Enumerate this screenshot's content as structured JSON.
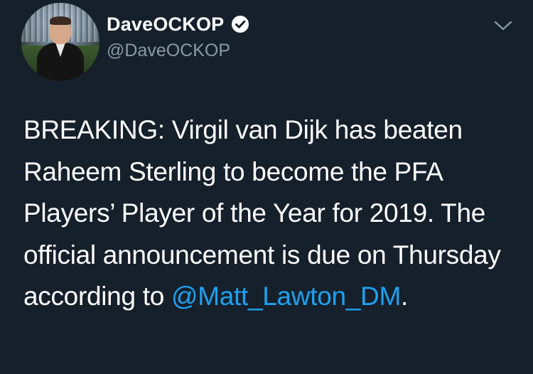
{
  "author": {
    "display_name": "DaveOCKOP",
    "handle": "@DaveOCKOP",
    "verified": true,
    "avatar_icon": "profile-photo"
  },
  "tweet": {
    "text_before": "BREAKING: Virgil van Dijk has beaten Raheem Sterling to become the PFA Players’ Player of the Year for 2019. The official announcement is due on Thursday according to ",
    "mention": "@Matt_Lawton_DM",
    "text_after": "."
  },
  "colors": {
    "background": "#15202b",
    "text": "#ffffff",
    "muted": "#8899a6",
    "link": "#1da1f2"
  },
  "icons": {
    "verified": "verified-badge-icon",
    "menu": "chevron-down-icon"
  }
}
